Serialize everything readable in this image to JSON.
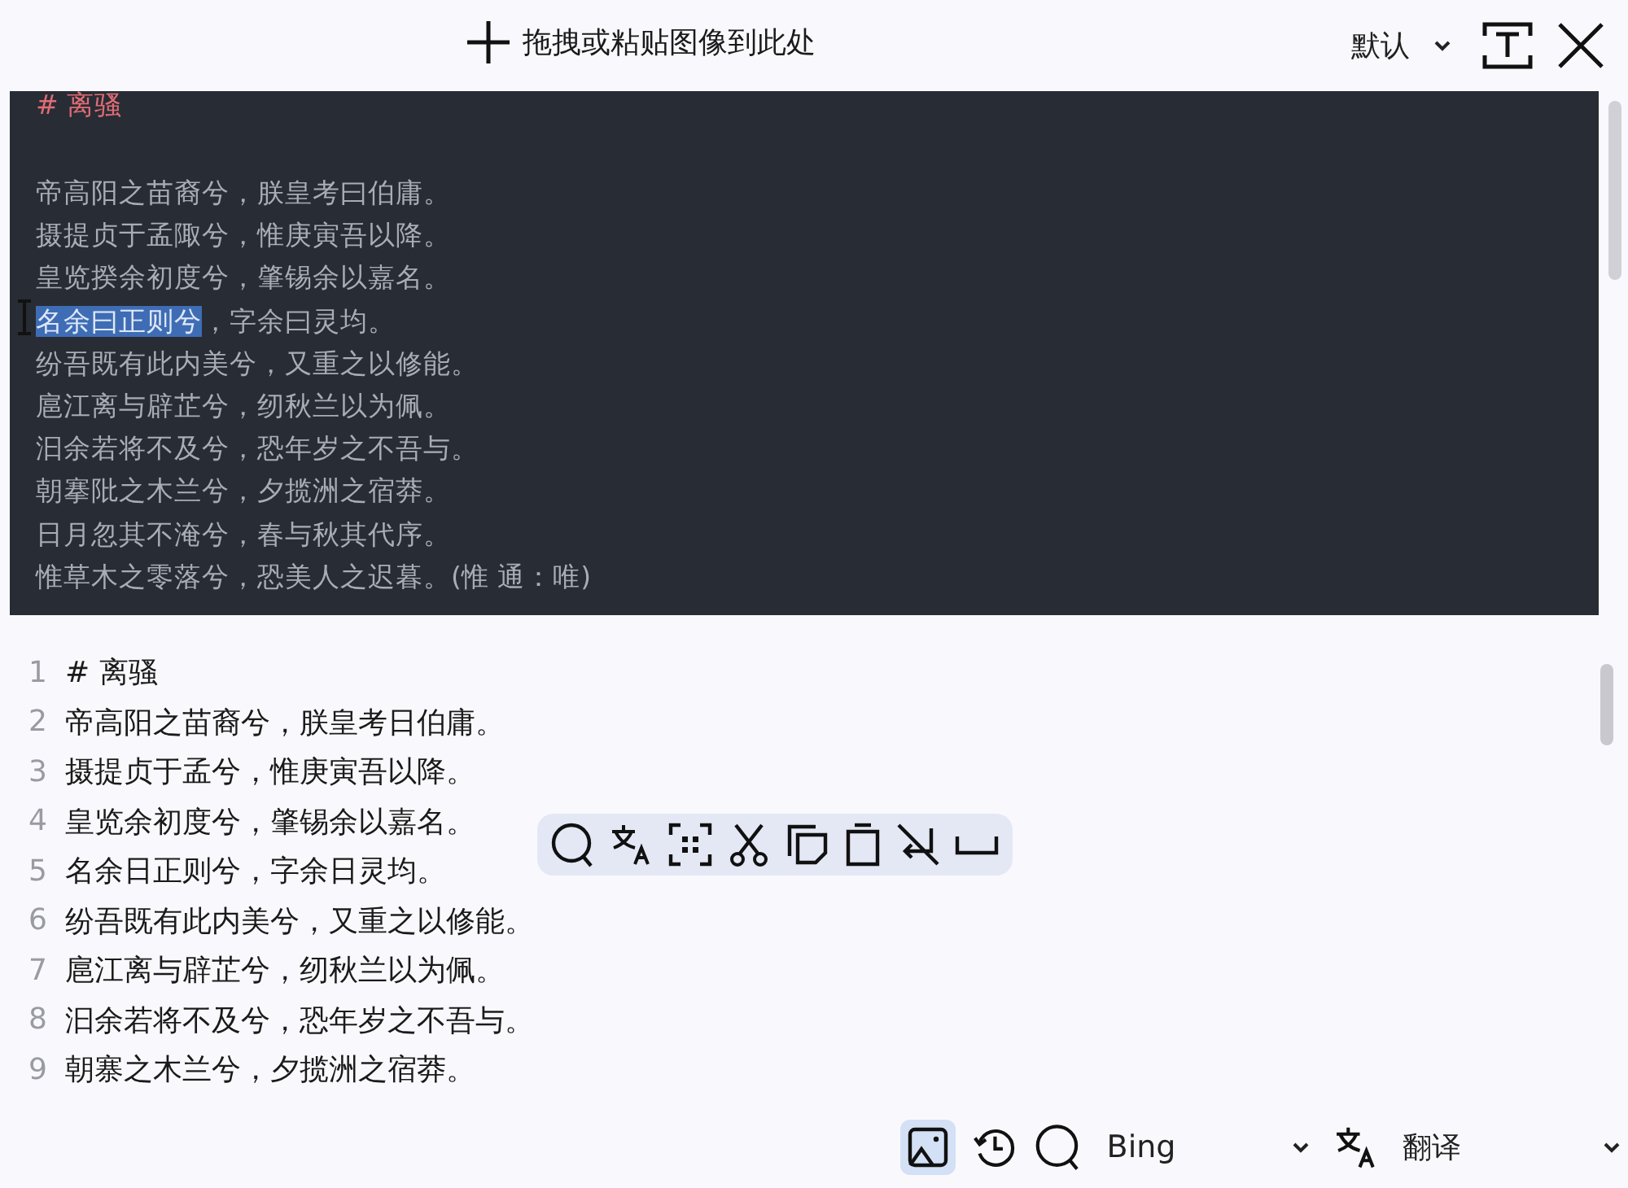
{
  "top_bar": {
    "drop_hint": "拖拽或粘贴图像到此处",
    "mode": "默认"
  },
  "image_preview": {
    "title_mark": "#",
    "title": "离骚",
    "lines": [
      [
        {
          "text": "帝高阳之苗裔兮，朕皇考曰伯庸。",
          "selected": false
        }
      ],
      [
        {
          "text": "摄提贞于孟陬兮，惟庚寅吾以降。",
          "selected": false
        }
      ],
      [
        {
          "text": "皇览揆余初度兮，肇锡余以嘉名。",
          "selected": false
        }
      ],
      [
        {
          "text": "名余曰正则兮",
          "selected": true
        },
        {
          "text": "，字余曰灵均。",
          "selected": false
        }
      ],
      [
        {
          "text": "纷吾既有此内美兮，又重之以修能。",
          "selected": false
        }
      ],
      [
        {
          "text": "扈江离与辟芷兮，纫秋兰以为佩。",
          "selected": false
        }
      ],
      [
        {
          "text": "汩余若将不及兮，恐年岁之不吾与。",
          "selected": false
        }
      ],
      [
        {
          "text": "朝搴阰之木兰兮，夕揽洲之宿莽。",
          "selected": false
        }
      ],
      [
        {
          "text": "日月忽其不淹兮，春与秋其代序。",
          "selected": false
        }
      ],
      [
        {
          "text": "惟草木之零落兮，恐美人之迟暮。(惟  通：唯)",
          "selected": false
        }
      ]
    ]
  },
  "editor": {
    "lines": [
      {
        "number": "1",
        "text": "# 离骚"
      },
      {
        "number": "2",
        "text": "帝高阳之苗裔兮，朕皇考日伯庸。"
      },
      {
        "number": "3",
        "text": "摄提贞于孟兮，惟庚寅吾以降。"
      },
      {
        "number": "4",
        "text": "皇览余初度兮，肇锡余以嘉名。"
      },
      {
        "number": "5",
        "text": "名余日正则兮，字余日灵均。"
      },
      {
        "number": "6",
        "text": "纷吾既有此内美兮，又重之以修能。"
      },
      {
        "number": "7",
        "text": "扈江离与辟芷兮，纫秋兰以为佩。"
      },
      {
        "number": "8",
        "text": "汩余若将不及兮，恐年岁之不吾与。"
      },
      {
        "number": "9",
        "text": "朝寨之木兰兮，夕揽洲之宿莽。"
      }
    ]
  },
  "context_toolbar": [
    {
      "kind": "search"
    },
    {
      "kind": "translate"
    },
    {
      "kind": "scan"
    },
    {
      "kind": "cut"
    },
    {
      "kind": "copy"
    },
    {
      "kind": "paste"
    },
    {
      "kind": "nowrap"
    },
    {
      "kind": "space"
    }
  ],
  "bottom_bar": {
    "image_selected": true,
    "search_engine": "Bing",
    "action": "翻译"
  }
}
